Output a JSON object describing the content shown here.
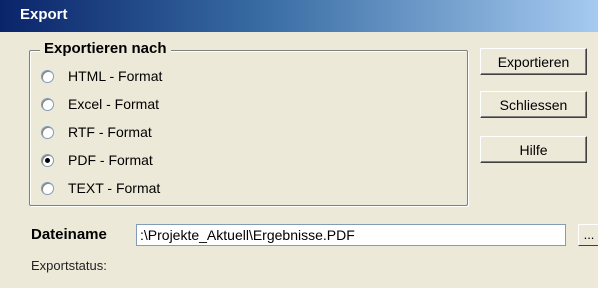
{
  "window": {
    "title": "Export"
  },
  "export_group": {
    "legend": "Exportieren nach",
    "options": [
      {
        "label": "HTML - Format",
        "checked": false
      },
      {
        "label": "Excel - Format",
        "checked": false
      },
      {
        "label": "RTF - Format",
        "checked": false
      },
      {
        "label": "PDF - Format",
        "checked": true
      },
      {
        "label": "TEXT - Format",
        "checked": false
      }
    ]
  },
  "buttons": {
    "export": "Exportieren",
    "close": "Schliessen",
    "help": "Hilfe",
    "browse": "..."
  },
  "file": {
    "label": "Dateiname",
    "value": ":\\Projekte_Aktuell\\Ergebnisse.PDF"
  },
  "status": {
    "label": "Exportstatus:"
  }
}
